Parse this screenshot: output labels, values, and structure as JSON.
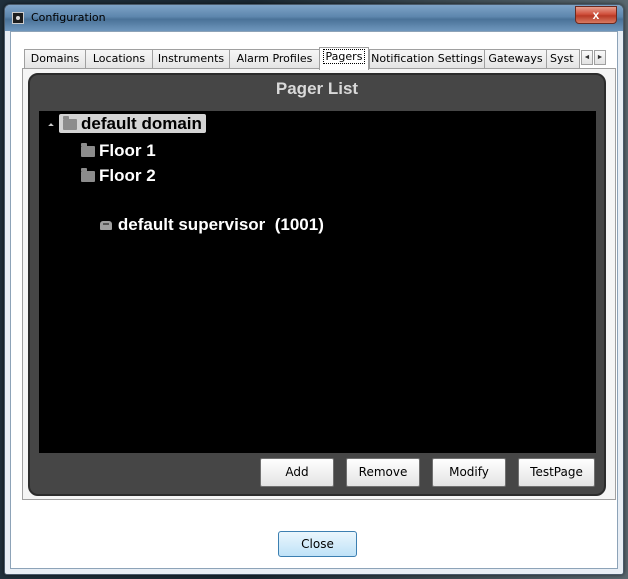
{
  "window": {
    "title": "Configuration",
    "close_glyph": "x"
  },
  "tabs": [
    {
      "label": "Domains"
    },
    {
      "label": "Locations"
    },
    {
      "label": "Instruments"
    },
    {
      "label": "Alarm Profiles"
    },
    {
      "label": "Pagers",
      "active": true
    },
    {
      "label": "Notification Settings"
    },
    {
      "label": "Gateways"
    },
    {
      "label": "Syst"
    }
  ],
  "tab_scroll": {
    "left": "◄",
    "right": "►"
  },
  "panel": {
    "title": "Pager List"
  },
  "tree": {
    "root": {
      "label": "default domain",
      "icon": "folder-icon",
      "selected": true
    },
    "children": [
      {
        "label": "Floor 1",
        "icon": "folder-icon"
      },
      {
        "label": "Floor 2",
        "icon": "folder-icon"
      },
      {
        "label": "default supervisor  (1001)",
        "icon": "pager-user-icon"
      }
    ]
  },
  "buttons": {
    "add": "Add",
    "remove": "Remove",
    "modify": "Modify",
    "testpage": "TestPage",
    "close": "Close"
  }
}
